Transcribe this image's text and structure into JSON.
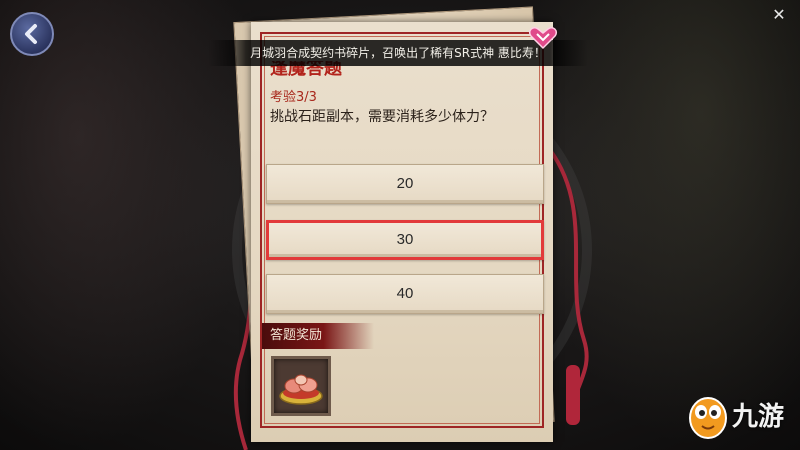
{
  "notice": "月城羽合成契约书碎片，召唤出了稀有SR式神 惠比寿！",
  "quiz": {
    "title": "逢魔答题",
    "progress": "考验3/3",
    "question": "挑战石距副本，需要消耗多少体力？",
    "options": [
      "20",
      "30",
      "40"
    ],
    "selected_index": 1
  },
  "reward": {
    "label": "答题奖励",
    "icon": "food-dish-icon"
  },
  "watermark": {
    "text": "九游",
    "icon": "mascot-icon"
  },
  "colors": {
    "accent": "#b2241c",
    "highlight": "#e23a3a",
    "paper": "#e7dbc6"
  }
}
